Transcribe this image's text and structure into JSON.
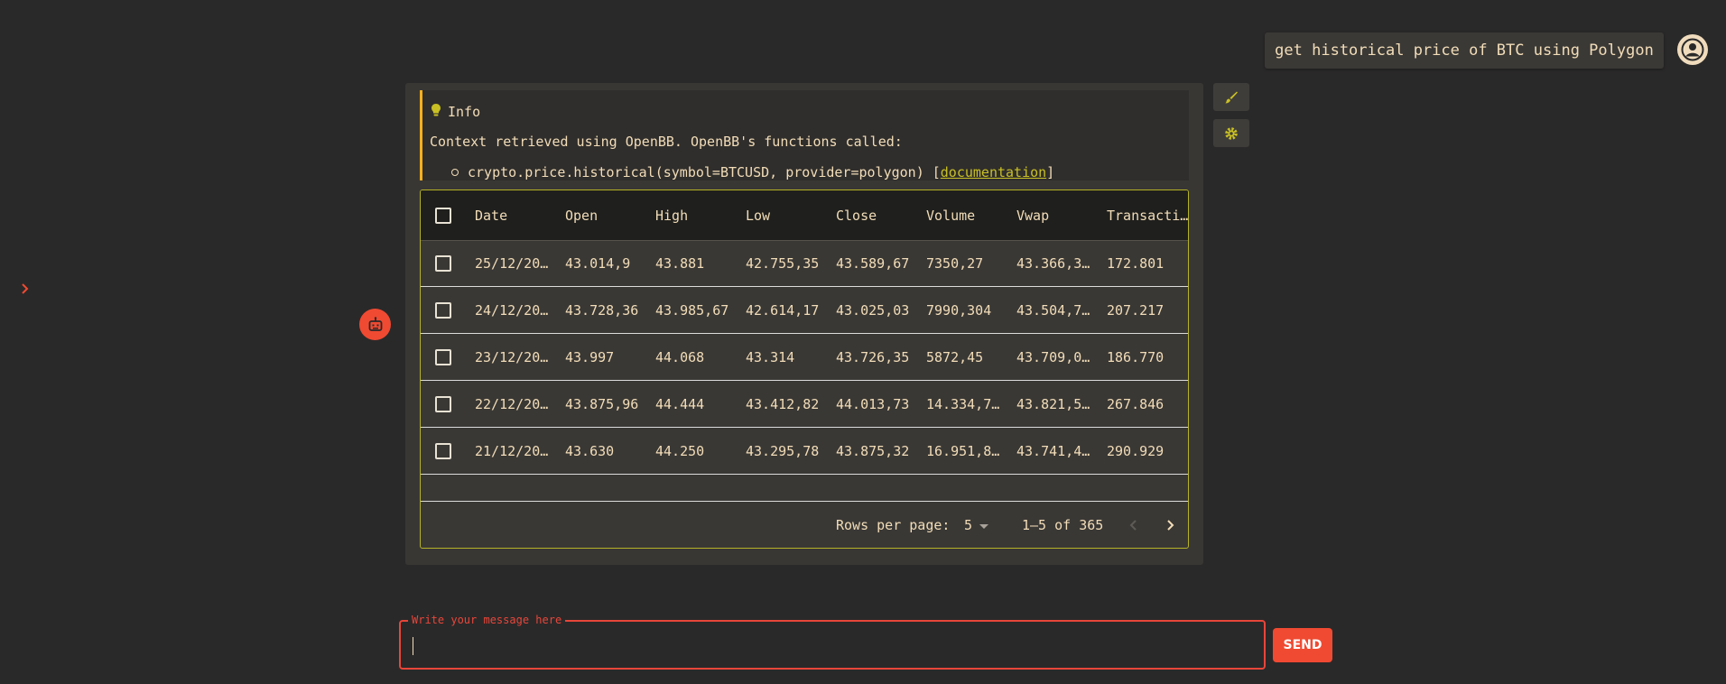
{
  "user_message": "get historical price of BTC using Polygon",
  "info": {
    "title": "Info",
    "text": "Context retrieved using OpenBB. OpenBB's functions called:",
    "function_call": "crypto.price.historical(symbol=BTCUSD, provider=polygon)",
    "bracket_open": "[",
    "link_text": "documentation",
    "bracket_close": "]"
  },
  "table": {
    "columns": [
      "Date",
      "Open",
      "High",
      "Low",
      "Close",
      "Volume",
      "Vwap",
      "Transacti…"
    ],
    "rows": [
      [
        "25/12/20…",
        "43.014,9",
        "43.881",
        "42.755,35",
        "43.589,67",
        "7350,27",
        "43.366,3…",
        "172.801"
      ],
      [
        "24/12/20…",
        "43.728,36",
        "43.985,67",
        "42.614,17",
        "43.025,03",
        "7990,304",
        "43.504,7…",
        "207.217"
      ],
      [
        "23/12/20…",
        "43.997",
        "44.068",
        "43.314",
        "43.726,35",
        "5872,45",
        "43.709,0…",
        "186.770"
      ],
      [
        "22/12/20…",
        "43.875,96",
        "44.444",
        "43.412,82",
        "44.013,73",
        "14.334,7…",
        "43.821,5…",
        "267.846"
      ],
      [
        "21/12/20…",
        "43.630",
        "44.250",
        "43.295,78",
        "43.875,32",
        "16.951,8…",
        "43.741,4…",
        "290.929"
      ]
    ],
    "rows_per_page_label": "Rows per page:",
    "rows_per_page_value": "5",
    "range_label": "1–5 of 365"
  },
  "input": {
    "label": "Write your message here",
    "value": ""
  },
  "send_label": "SEND",
  "colors": {
    "background": "#2a2929",
    "accent": "#f04a32",
    "info_border": "#f5b021",
    "table_border": "#b4b326",
    "text": "#f2ddb8"
  },
  "icons": {
    "info": "lightbulb-icon",
    "user": "user-avatar-icon",
    "bot": "robot-icon",
    "edit": "brush-icon",
    "settings": "gear-icon",
    "expand": "chevron-right-icon"
  }
}
